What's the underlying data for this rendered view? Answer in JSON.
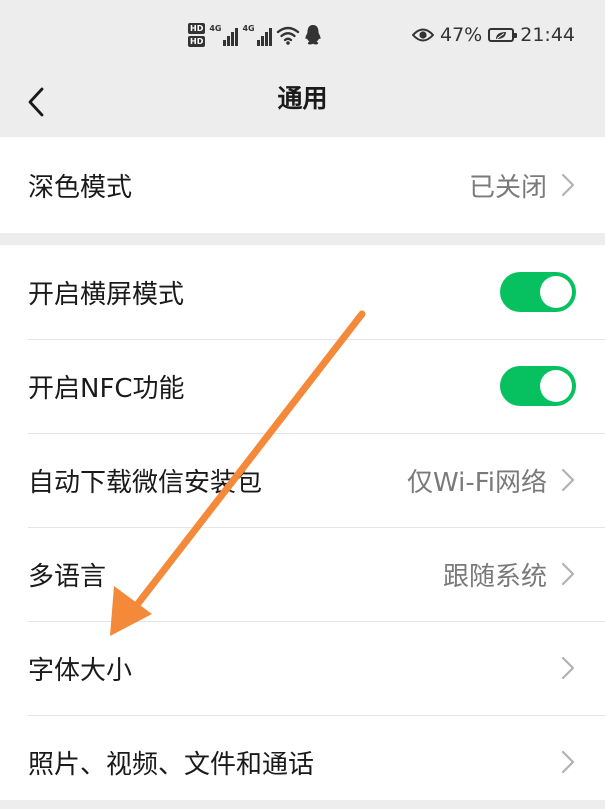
{
  "status_bar": {
    "hd_top": "HD",
    "hd_bottom": "HD",
    "net1": "4G",
    "net2": "4G",
    "battery": "47%",
    "time": "21:44",
    "icons": [
      "hd-icon",
      "signal-icon",
      "wifi-icon",
      "qq-icon",
      "eye-icon",
      "battery-icon"
    ]
  },
  "header": {
    "title": "通用",
    "back_icon": "chevron-left-icon"
  },
  "groups": [
    {
      "items": [
        {
          "label": "深色模式",
          "value": "已关闭",
          "type": "link"
        }
      ]
    },
    {
      "items": [
        {
          "label": "开启横屏模式",
          "type": "toggle",
          "on": true
        },
        {
          "label": "开启NFC功能",
          "type": "toggle",
          "on": true
        },
        {
          "label": "自动下载微信安装包",
          "value": "仅Wi-Fi网络",
          "type": "link"
        },
        {
          "label": "多语言",
          "value": "跟随系统",
          "type": "link"
        },
        {
          "label": "字体大小",
          "value": "",
          "type": "link"
        },
        {
          "label": "照片、视频、文件和通话",
          "value": "",
          "type": "link"
        }
      ]
    }
  ],
  "annotation": {
    "type": "arrow",
    "color": "#f5893a"
  },
  "colors": {
    "toggle_on": "#07c160",
    "chevron": "#b2b2b2",
    "background": "#ededed"
  }
}
